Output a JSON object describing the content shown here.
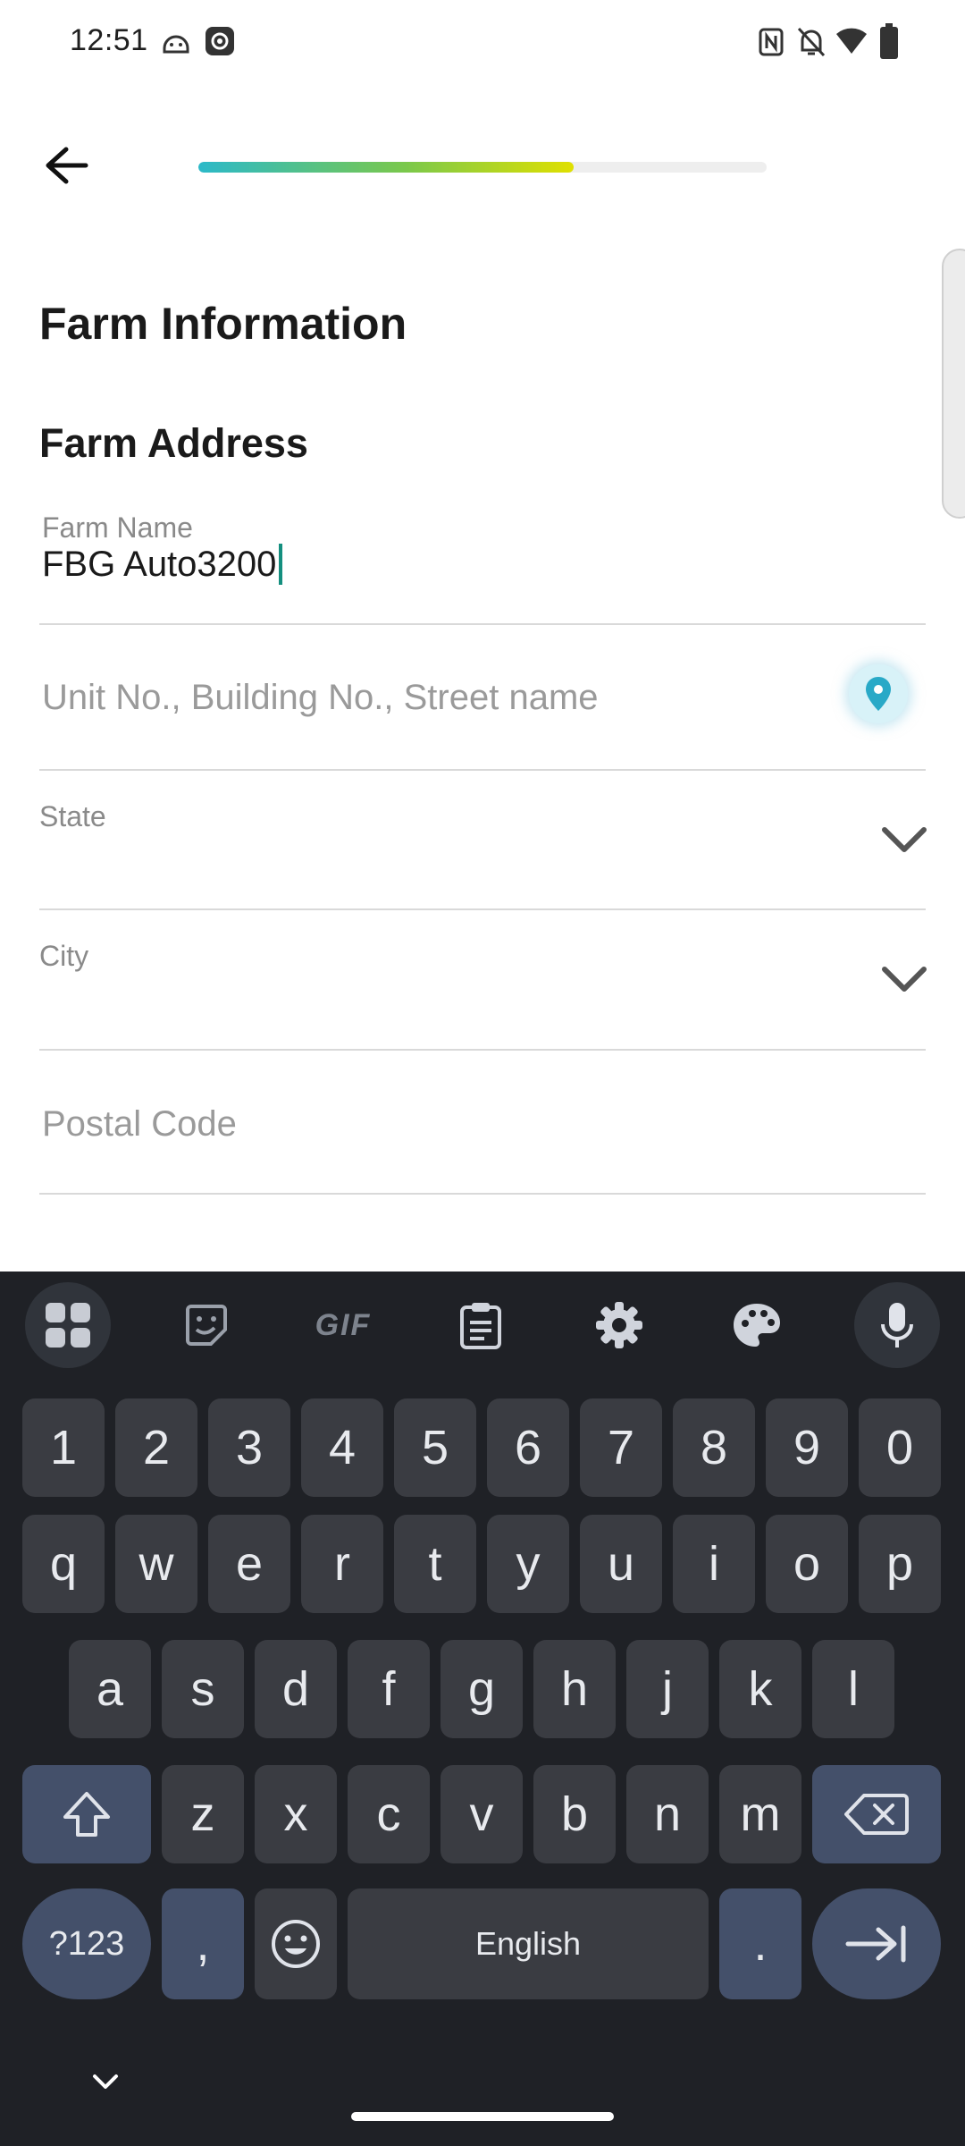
{
  "status_bar": {
    "time": "12:51",
    "left_icons": [
      "android-head-icon",
      "settings-gear-icon"
    ],
    "right_icons": [
      "nfc-icon",
      "notifications-off-icon",
      "wifi-icon",
      "battery-icon"
    ]
  },
  "header": {
    "back_icon": "arrow-left-icon",
    "progress_percent": 66
  },
  "page": {
    "title": "Farm Information",
    "section_title": "Farm Address"
  },
  "form": {
    "farm_name": {
      "label": "Farm Name",
      "value": "FBG Auto3200"
    },
    "street": {
      "placeholder": "Unit No., Building No., Street name",
      "icon": "location-pin-icon"
    },
    "state": {
      "label": "State",
      "value": ""
    },
    "city": {
      "label": "City",
      "value": ""
    },
    "postal_code": {
      "placeholder": "Postal Code"
    }
  },
  "keyboard": {
    "toolbar": [
      "apps-grid-icon",
      "sticker-icon",
      "gif-icon",
      "clipboard-icon",
      "settings-icon",
      "palette-icon",
      "microphone-icon"
    ],
    "toolbar_gif_label": "GIF",
    "number_row": [
      "1",
      "2",
      "3",
      "4",
      "5",
      "6",
      "7",
      "8",
      "9",
      "0"
    ],
    "row1": [
      "q",
      "w",
      "e",
      "r",
      "t",
      "y",
      "u",
      "i",
      "o",
      "p"
    ],
    "row2": [
      "a",
      "s",
      "d",
      "f",
      "g",
      "h",
      "j",
      "k",
      "l"
    ],
    "row3": [
      "z",
      "x",
      "c",
      "v",
      "b",
      "n",
      "m"
    ],
    "symbols_key": "?123",
    "comma_key": ",",
    "space_label": "English",
    "period_key": "."
  },
  "colors": {
    "accent": "#148f7f",
    "progress_start": "#2bb9c9",
    "progress_end": "#e0e000",
    "pin": "#29a9c7",
    "keyboard_bg": "#1f2126"
  }
}
